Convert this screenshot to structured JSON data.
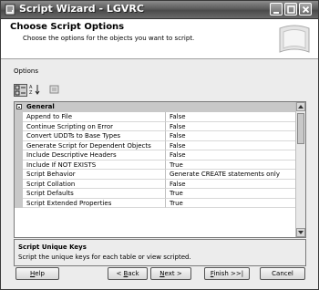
{
  "window": {
    "title": "Script Wizard - LGVRC"
  },
  "header": {
    "title": "Choose Script Options",
    "subtitle": "Choose the options for the objects you want to script."
  },
  "options_label": "Options",
  "grid": {
    "category": "General",
    "rows": [
      {
        "name": "Append to File",
        "value": "False"
      },
      {
        "name": "Continue Scripting on Error",
        "value": "False"
      },
      {
        "name": "Convert UDDTs to Base Types",
        "value": "False"
      },
      {
        "name": "Generate Script for Dependent Objects",
        "value": "False"
      },
      {
        "name": "Include Descriptive Headers",
        "value": "False"
      },
      {
        "name": "Include If NOT EXISTS",
        "value": "True"
      },
      {
        "name": "Script Behavior",
        "value": "Generate CREATE statements only"
      },
      {
        "name": "Script Collation",
        "value": "False"
      },
      {
        "name": "Script Defaults",
        "value": "True"
      },
      {
        "name": "Script Extended Properties",
        "value": "True"
      }
    ]
  },
  "description": {
    "title": "Script Unique Keys",
    "text": "Script the unique keys for each table or view scripted."
  },
  "buttons": {
    "help": {
      "accel": "H",
      "rest": "elp"
    },
    "back": {
      "prefix": "< ",
      "accel": "B",
      "rest": "ack"
    },
    "next": {
      "accel": "N",
      "rest": "ext >"
    },
    "finish": {
      "accel": "F",
      "rest": "inish >>|"
    },
    "cancel": "Cancel"
  },
  "icons": {
    "app": "script-wizard-icon",
    "categorized": "categorized-icon",
    "alphabetical": "alphabetical-sort-icon",
    "property_pages": "property-pages-icon"
  }
}
